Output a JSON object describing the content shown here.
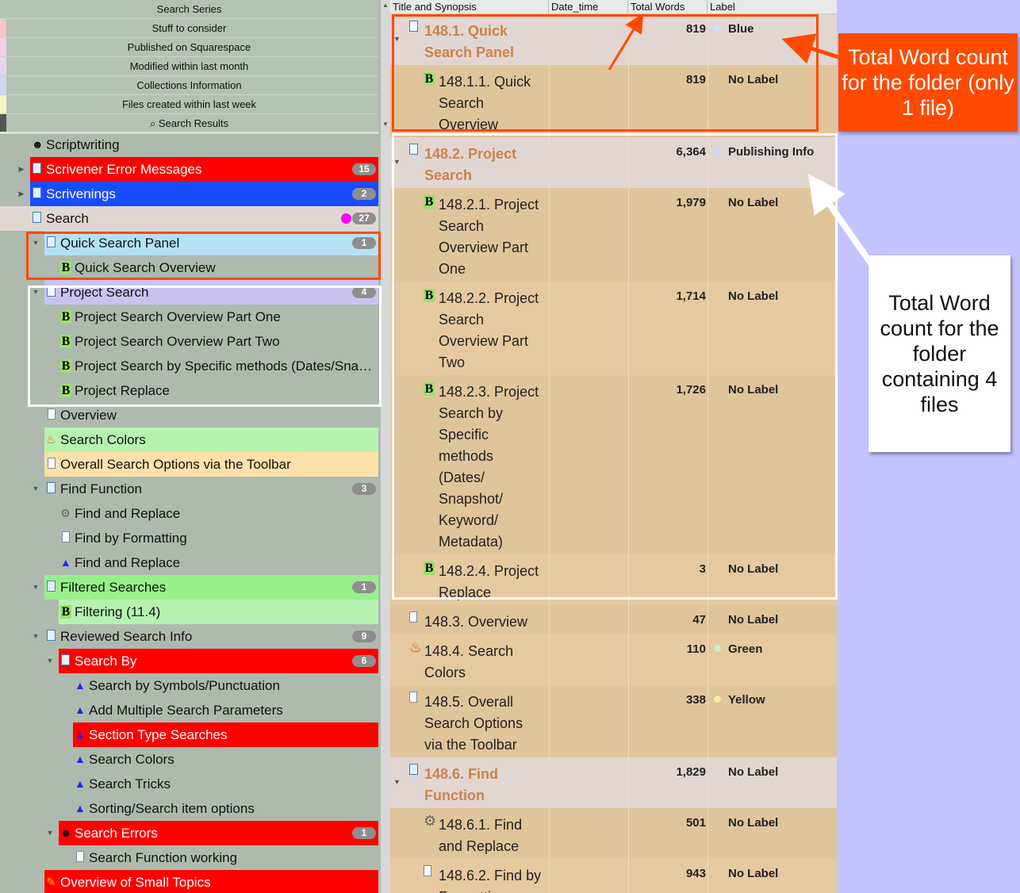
{
  "collections": [
    {
      "label": "Search Series",
      "color": "#b4c2b4"
    },
    {
      "label": "Stuff to consider",
      "color": "#f5c3c8"
    },
    {
      "label": "Published on Squarespace",
      "color": "#f5cde8"
    },
    {
      "label": "Modified within last month",
      "color": "#e9d3f3"
    },
    {
      "label": "Collections Information",
      "color": "#d3d3f7"
    },
    {
      "label": "Files created within last week",
      "color": "#f3f3c4"
    },
    {
      "label": "⌕ Search Results",
      "color": "#555555"
    }
  ],
  "binder": [
    {
      "label": "Scriptwriting",
      "icon": "alien-icon",
      "depth": 0,
      "disc": "",
      "badge": "",
      "bg": ""
    },
    {
      "label": "Scrivener Error Messages",
      "icon": "folder-icon",
      "depth": 0,
      "disc": "right",
      "badge": "15",
      "bg": "#ff0000",
      "fg": "#ffffff"
    },
    {
      "label": "Scrivenings",
      "icon": "folder-icon",
      "depth": 0,
      "disc": "right",
      "badge": "2",
      "bg": "#1a4cff",
      "fg": "#ffffff"
    },
    {
      "label": "Search",
      "icon": "folder-icon",
      "depth": 0,
      "disc": "",
      "badge": "27",
      "bg": "#e2d6d2",
      "dot": "#ff00ff"
    },
    {
      "label": "Quick Search Panel",
      "icon": "folder-icon",
      "depth": 1,
      "disc": "down",
      "badge": "1",
      "bg": "#b4e2f4"
    },
    {
      "label": "Quick Search Overview",
      "icon": "b-icon",
      "depth": 2,
      "disc": "",
      "badge": "",
      "bg": ""
    },
    {
      "label": "Project Search",
      "icon": "folder-doc-icon",
      "depth": 1,
      "disc": "down",
      "badge": "4",
      "bg": "#c9c3f2"
    },
    {
      "label": "Project Search Overview Part One",
      "icon": "b-icon",
      "depth": 2,
      "disc": "",
      "badge": "",
      "bg": ""
    },
    {
      "label": "Project Search Overview Part Two",
      "icon": "b-icon",
      "depth": 2,
      "disc": "",
      "badge": "",
      "bg": ""
    },
    {
      "label": "Project Search by Specific methods (Dates/Snap…",
      "icon": "b-icon",
      "depth": 2,
      "disc": "",
      "badge": "",
      "bg": ""
    },
    {
      "label": "Project Replace",
      "icon": "b-icon",
      "depth": 2,
      "disc": "",
      "badge": "",
      "bg": ""
    },
    {
      "label": "Overview",
      "icon": "doc-icon",
      "depth": 1,
      "disc": "",
      "badge": "",
      "bg": ""
    },
    {
      "label": "Search Colors",
      "icon": "flame-icon",
      "depth": 1,
      "disc": "",
      "badge": "",
      "bg": "#b5f2b0"
    },
    {
      "label": "Overall Search Options via the Toolbar",
      "icon": "doc-icon",
      "depth": 1,
      "disc": "",
      "badge": "",
      "bg": "#fde1a8"
    },
    {
      "label": "Find Function",
      "icon": "folder-icon",
      "depth": 1,
      "disc": "down",
      "badge": "3",
      "bg": ""
    },
    {
      "label": "Find and Replace",
      "icon": "gear-icon",
      "depth": 2,
      "disc": "",
      "badge": "",
      "bg": ""
    },
    {
      "label": "Find by Formatting",
      "icon": "doc-icon",
      "depth": 2,
      "disc": "",
      "badge": "",
      "bg": ""
    },
    {
      "label": "Find and Replace",
      "icon": "triangle-icon",
      "depth": 2,
      "disc": "",
      "badge": "",
      "bg": ""
    },
    {
      "label": "Filtered Searches",
      "icon": "folder-icon",
      "depth": 1,
      "disc": "down",
      "badge": "1",
      "bg": "#97f08a"
    },
    {
      "label": "Filtering (11.4)",
      "icon": "b-icon",
      "depth": 2,
      "disc": "",
      "badge": "",
      "bg": "#b5f2b0"
    },
    {
      "label": "Reviewed Search Info",
      "icon": "folder-icon",
      "depth": 1,
      "disc": "down",
      "badge": "9",
      "bg": ""
    },
    {
      "label": "Search By",
      "icon": "folder-icon",
      "depth": 2,
      "disc": "down",
      "badge": "6",
      "bg": "#ff0000",
      "fg": "#ffffff"
    },
    {
      "label": "Search by Symbols/Punctuation",
      "icon": "triangle-icon",
      "depth": 3,
      "disc": "",
      "badge": "",
      "bg": ""
    },
    {
      "label": "Add Multiple Search Parameters",
      "icon": "triangle-icon",
      "depth": 3,
      "disc": "",
      "badge": "",
      "bg": ""
    },
    {
      "label": "Section Type Searches",
      "icon": "triangle-icon",
      "depth": 3,
      "disc": "",
      "badge": "",
      "bg": "#ff0000",
      "fg": "#ffffff"
    },
    {
      "label": "Search Colors",
      "icon": "triangle-icon",
      "depth": 3,
      "disc": "",
      "badge": "",
      "bg": ""
    },
    {
      "label": "Search Tricks",
      "icon": "triangle-icon",
      "depth": 3,
      "disc": "",
      "badge": "",
      "bg": ""
    },
    {
      "label": "Sorting/Search item options",
      "icon": "triangle-icon",
      "depth": 3,
      "disc": "",
      "badge": "",
      "bg": ""
    },
    {
      "label": "Search Errors",
      "icon": "alien-icon",
      "depth": 2,
      "disc": "down",
      "badge": "1",
      "bg": "#ff0000",
      "fg": "#ffffff"
    },
    {
      "label": "Search Function working",
      "icon": "doc-icon",
      "depth": 3,
      "disc": "",
      "badge": "",
      "bg": ""
    },
    {
      "label": "Overview of Small Topics",
      "icon": "pencil-icon",
      "depth": 1,
      "disc": "",
      "badge": "",
      "bg": "#ff0000",
      "fg": "#ffffff"
    }
  ],
  "outline": {
    "columns": [
      "Title and Synopsis",
      "Date_time",
      "Total Words",
      "Label"
    ],
    "rows": [
      {
        "title_lines": [
          "148.1. Quick",
          "Search Panel"
        ],
        "icon": "folder-doc-icon",
        "depth": 0,
        "folder": true,
        "disc": true,
        "words": "819",
        "label": "Blue",
        "dot": "#cfe0f8",
        "h": 64
      },
      {
        "title_lines": [
          "148.1.1. Quick",
          "Search",
          "Overview"
        ],
        "icon": "b-icon",
        "depth": 1,
        "folder": false,
        "words": "819",
        "label": "No Label",
        "dot": "",
        "h": 91
      },
      {
        "title_lines": [
          "148.2. Project",
          "Search"
        ],
        "icon": "folder-doc-icon",
        "depth": 0,
        "folder": true,
        "disc": true,
        "words": "6,364",
        "label": "Publishing Info",
        "dot": "#d3d3f7",
        "h": 64
      },
      {
        "title_lines": [
          "148.2.1. Project",
          "Search",
          "Overview Part",
          "One"
        ],
        "icon": "b-icon",
        "depth": 1,
        "folder": false,
        "words": "1,979",
        "label": "No Label",
        "dot": "",
        "h": 118
      },
      {
        "title_lines": [
          "148.2.2. Project",
          "Search",
          "Overview Part",
          "Two"
        ],
        "icon": "b-icon",
        "depth": 1,
        "folder": false,
        "words": "1,714",
        "label": "No Label",
        "dot": "",
        "h": 118
      },
      {
        "title_lines": [
          "148.2.3. Project",
          "Search by",
          "Specific",
          "methods",
          "(Dates/",
          "Snapshot/",
          "Keyword/",
          "Metadata)"
        ],
        "icon": "b-icon",
        "depth": 1,
        "folder": false,
        "words": "1,726",
        "label": "No Label",
        "dot": "",
        "h": 226
      },
      {
        "title_lines": [
          "148.2.4. Project",
          "Replace"
        ],
        "icon": "b-icon",
        "depth": 1,
        "folder": false,
        "words": "3",
        "label": "No Label",
        "dot": "",
        "h": 64
      },
      {
        "title_lines": [
          "148.3. Overview"
        ],
        "icon": "doc-icon",
        "depth": 0,
        "folder": false,
        "words": "47",
        "label": "No Label",
        "dot": "",
        "h": 37
      },
      {
        "title_lines": [
          "148.4. Search",
          "Colors"
        ],
        "icon": "flame-icon",
        "depth": 0,
        "folder": false,
        "words": "110",
        "label": "Green",
        "dot": "#c8f0c8",
        "h": 64
      },
      {
        "title_lines": [
          "148.5. Overall",
          "Search Options",
          "via the Toolbar"
        ],
        "icon": "doc-icon",
        "depth": 0,
        "folder": false,
        "words": "338",
        "label": "Yellow",
        "dot": "#fbe8a0",
        "h": 91
      },
      {
        "title_lines": [
          "148.6. Find",
          "Function"
        ],
        "icon": "folder-icon",
        "depth": 0,
        "folder": true,
        "disc": true,
        "words": "1,829",
        "label": "No Label",
        "dot": "",
        "h": 64
      },
      {
        "title_lines": [
          "148.6.1. Find",
          "and Replace"
        ],
        "icon": "gear-icon",
        "depth": 1,
        "folder": false,
        "words": "501",
        "label": "No Label",
        "dot": "",
        "h": 64
      },
      {
        "title_lines": [
          "148.6.2. Find by",
          "Formatting"
        ],
        "icon": "doc-icon",
        "depth": 1,
        "folder": false,
        "words": "943",
        "label": "No Label",
        "dot": "",
        "h": 64
      }
    ]
  },
  "annotations": {
    "callout1": "Total Word count for the folder (only 1 file)",
    "callout2": "Total Word count for the folder containing 4 files",
    "accent": "#ff4a00"
  }
}
